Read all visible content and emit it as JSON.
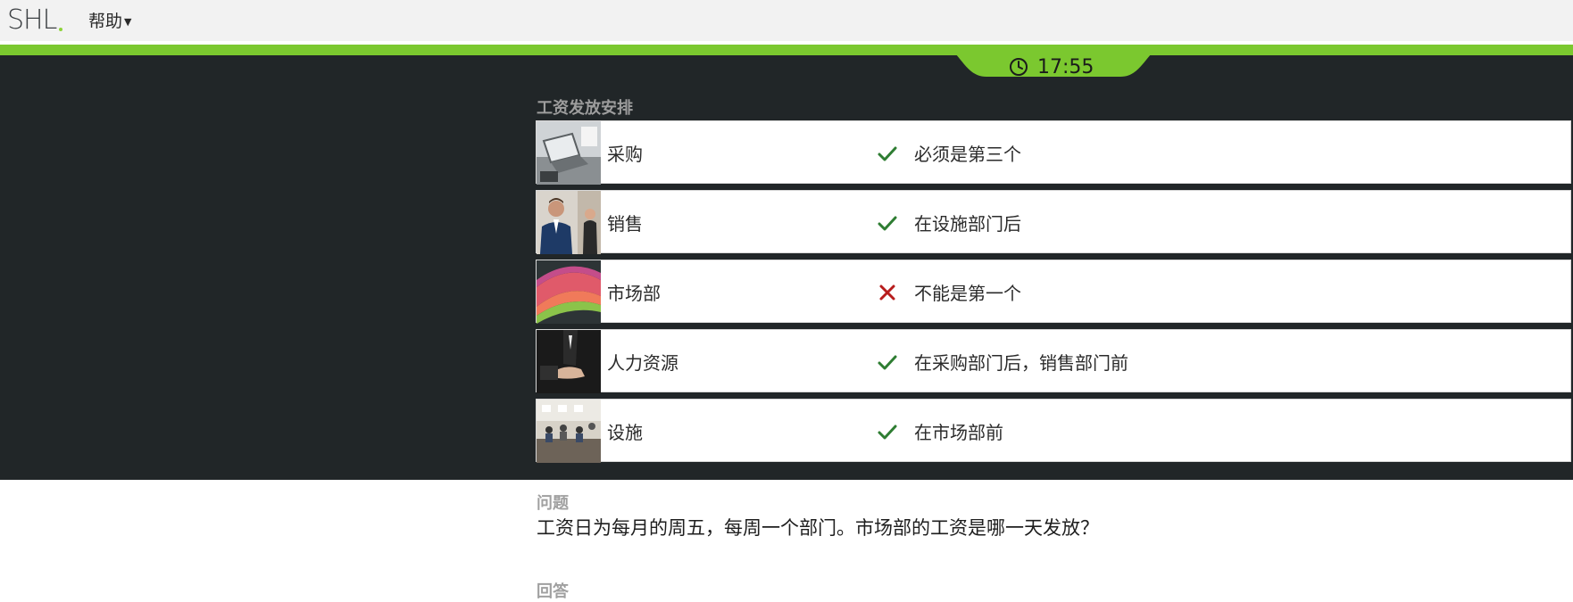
{
  "header": {
    "logo_text": "SHL",
    "help_label": "帮助",
    "brand_green": "#7bc82f"
  },
  "timer": {
    "icon": "clock-icon",
    "time": "17:55"
  },
  "schedule": {
    "title": "工资发放安排",
    "rows": [
      {
        "department": "采购",
        "status": "check",
        "rule": "必须是第三个",
        "thumb": "laptop-desk-photo"
      },
      {
        "department": "销售",
        "status": "check",
        "rule": "在设施部门后",
        "thumb": "business-people-photo"
      },
      {
        "department": "市场部",
        "status": "cross",
        "rule": "不能是第一个",
        "thumb": "color-chart-photo"
      },
      {
        "department": "人力资源",
        "status": "check",
        "rule": "在采购部门后，销售部门前",
        "thumb": "handshake-photo"
      },
      {
        "department": "设施",
        "status": "check",
        "rule": "在市场部前",
        "thumb": "office-room-photo"
      }
    ]
  },
  "question": {
    "label": "问题",
    "text": "工资日为每月的周五，每周一个部门。市场部的工资是哪一天发放？"
  },
  "answer": {
    "label": "回答"
  },
  "colors": {
    "check": "#2e7d32",
    "cross": "#b71c1c",
    "panel": "#212628"
  }
}
